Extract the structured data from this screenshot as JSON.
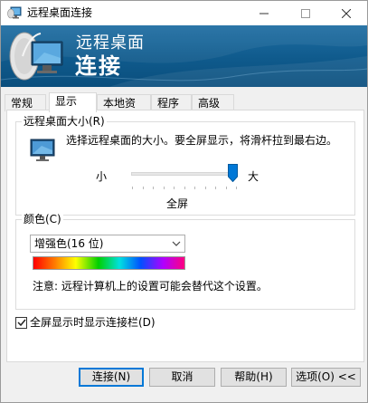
{
  "window": {
    "title": "远程桌面连接",
    "controls": {
      "minimize": "—",
      "maximize": "☐",
      "close": "✕"
    }
  },
  "banner": {
    "line1": "远程桌面",
    "line2": "连接",
    "colors": {
      "top": "#1f6ea3",
      "bottom": "#0a4e7d"
    }
  },
  "tabs": [
    {
      "label": "常规",
      "active": false
    },
    {
      "label": "显示",
      "active": true
    },
    {
      "label": "本地资源",
      "active": false
    },
    {
      "label": "程序",
      "active": false
    },
    {
      "label": "高级",
      "active": false
    }
  ],
  "display": {
    "size_group": {
      "title": "远程桌面大小(R)",
      "description": "选择远程桌面的大小。要全屏显示，将滑杆拉到最右边。",
      "slider": {
        "min_label": "小",
        "max_label": "大",
        "value_label": "全屏",
        "position": 1.0,
        "ticks": 11
      }
    },
    "color_group": {
      "title": "颜色(C)",
      "selected": "增强色(16 位)",
      "note": "注意: 远程计算机上的设置可能会替代这个设置。"
    },
    "fullscreen_bar": {
      "label": "全屏显示时显示连接栏(D)",
      "checked": true
    }
  },
  "buttons": {
    "connect": "连接(N)",
    "cancel": "取消",
    "help": "帮助(H)",
    "options": "选项(O) <<"
  },
  "colors": {
    "accent": "#0078d7"
  }
}
